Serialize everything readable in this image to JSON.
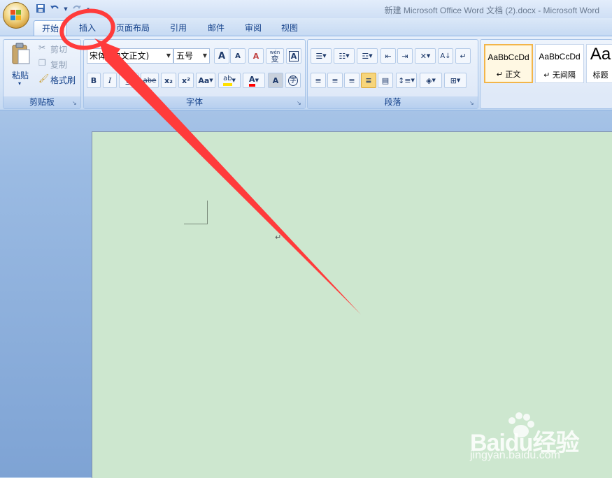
{
  "window": {
    "title": "新建 Microsoft Office Word 文档 (2).docx - Microsoft Word"
  },
  "quick_access": {
    "save_icon": "save-icon",
    "undo_icon": "undo-icon",
    "redo_icon": "redo-icon",
    "customize_icon": "dropdown-arrow-icon"
  },
  "tabs": [
    {
      "label": "开始",
      "active": true
    },
    {
      "label": "插入",
      "active": false
    },
    {
      "label": "页面布局",
      "active": false
    },
    {
      "label": "引用",
      "active": false
    },
    {
      "label": "邮件",
      "active": false
    },
    {
      "label": "审阅",
      "active": false
    },
    {
      "label": "视图",
      "active": false
    }
  ],
  "clipboard": {
    "group_label": "剪贴板",
    "paste_label": "粘贴",
    "cut_label": "剪切",
    "copy_label": "复制",
    "format_painter_label": "格式刷"
  },
  "font": {
    "group_label": "字体",
    "font_name": "宋体 (中文正文)",
    "font_size": "五号",
    "grow_label": "A",
    "shrink_label": "A",
    "clear_label": "A",
    "phonetic_label": "wén",
    "phonetic_char": "变",
    "border_label": "A",
    "bold_label": "B",
    "italic_label": "I",
    "underline_label": "U",
    "strike_label": "abe",
    "subscript_label": "x₂",
    "superscript_label": "x²",
    "case_label": "Aa",
    "highlight_label": "ab",
    "color_label": "A",
    "shade_label": "A",
    "enclose_label": "字"
  },
  "paragraph": {
    "group_label": "段落"
  },
  "styles": {
    "items": [
      {
        "sample": "AaBbCcDd",
        "name": "↵ 正文",
        "selected": true
      },
      {
        "sample": "AaBbCcDd",
        "name": "↵ 无间隔",
        "selected": false
      },
      {
        "sample": "Aa",
        "name": "标题",
        "selected": false
      }
    ]
  },
  "document": {
    "paragraph_mark": "↵"
  },
  "watermark": {
    "logo": "Baidu经验",
    "url": "jingyan.baidu.com"
  },
  "colors": {
    "annotation": "#ff3b3b",
    "page": "#cde7cf",
    "highlight_yellow": "#ffe000",
    "font_red": "#ff0000"
  }
}
